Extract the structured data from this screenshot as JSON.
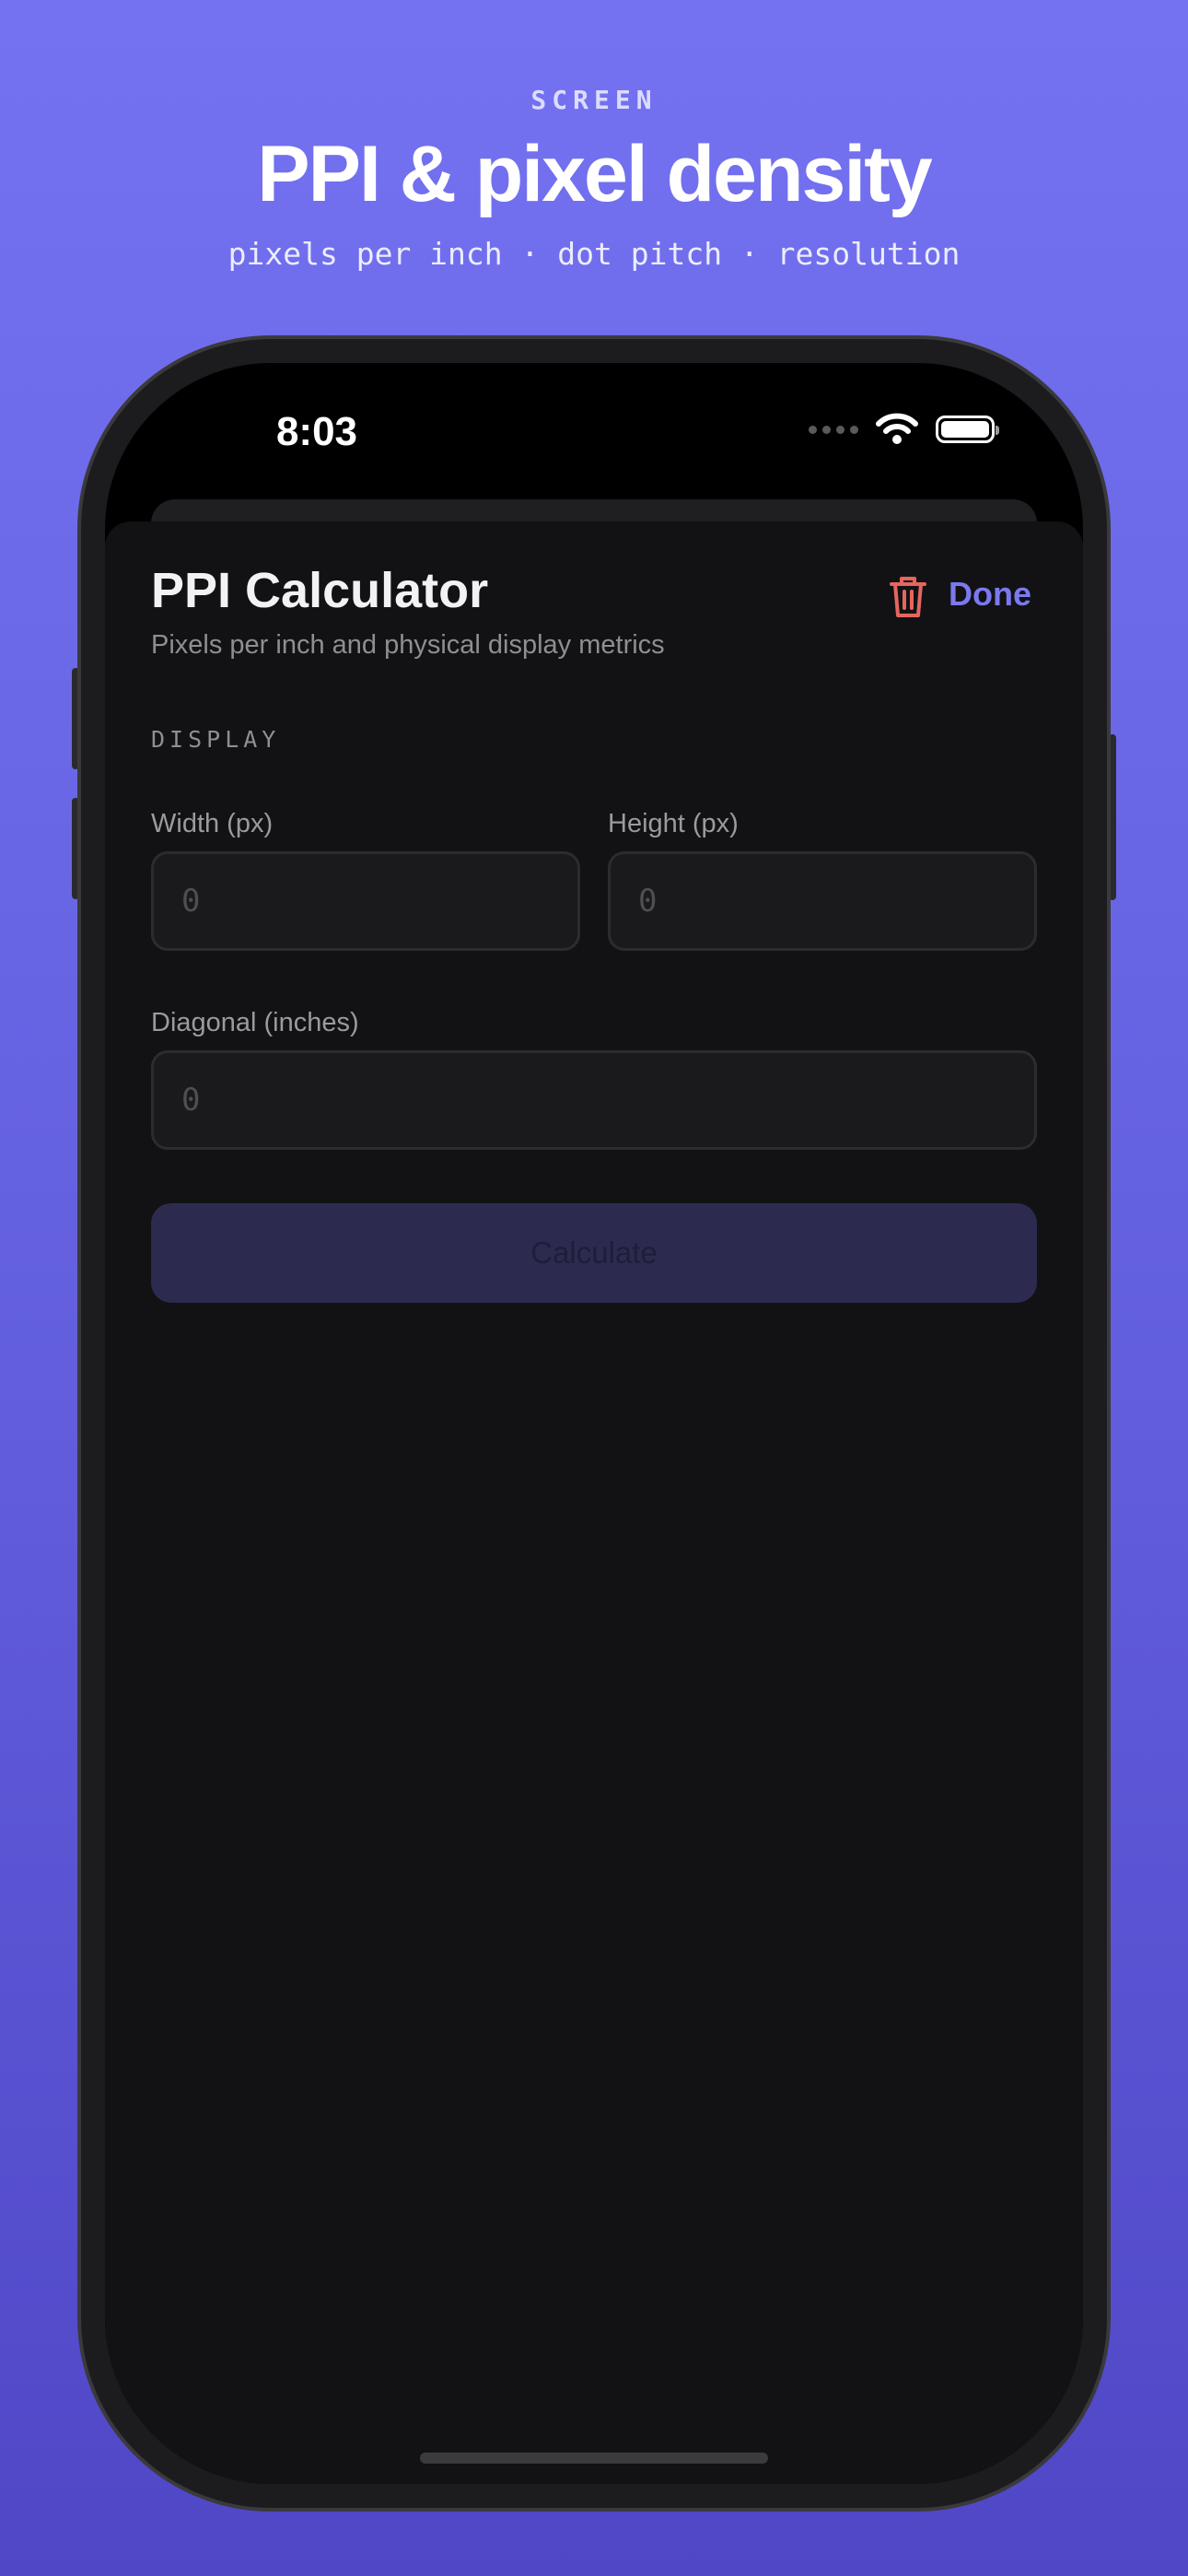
{
  "marketing": {
    "eyebrow": "SCREEN",
    "headline": "PPI & pixel density",
    "tagline": "pixels per inch · dot pitch · resolution"
  },
  "status_bar": {
    "time": "8:03",
    "icons": [
      "cellular-signal-icon",
      "wifi-icon",
      "battery-icon"
    ]
  },
  "sheet": {
    "title": "PPI Calculator",
    "subtitle": "Pixels per inch and physical display metrics",
    "done_label": "Done",
    "trash_icon": "trash-icon",
    "section_label": "DISPLAY",
    "fields": {
      "width_label": "Width (px)",
      "width_placeholder": "0",
      "height_label": "Height (px)",
      "height_placeholder": "0",
      "diagonal_label": "Diagonal (inches)",
      "diagonal_placeholder": "0"
    },
    "calculate_label": "Calculate"
  },
  "colors": {
    "accent": "#7c78ee",
    "destructive": "#e5665f",
    "sheet_background": "#121214",
    "page_gradient_top": "#7472f0",
    "page_gradient_bottom": "#5047c6"
  }
}
